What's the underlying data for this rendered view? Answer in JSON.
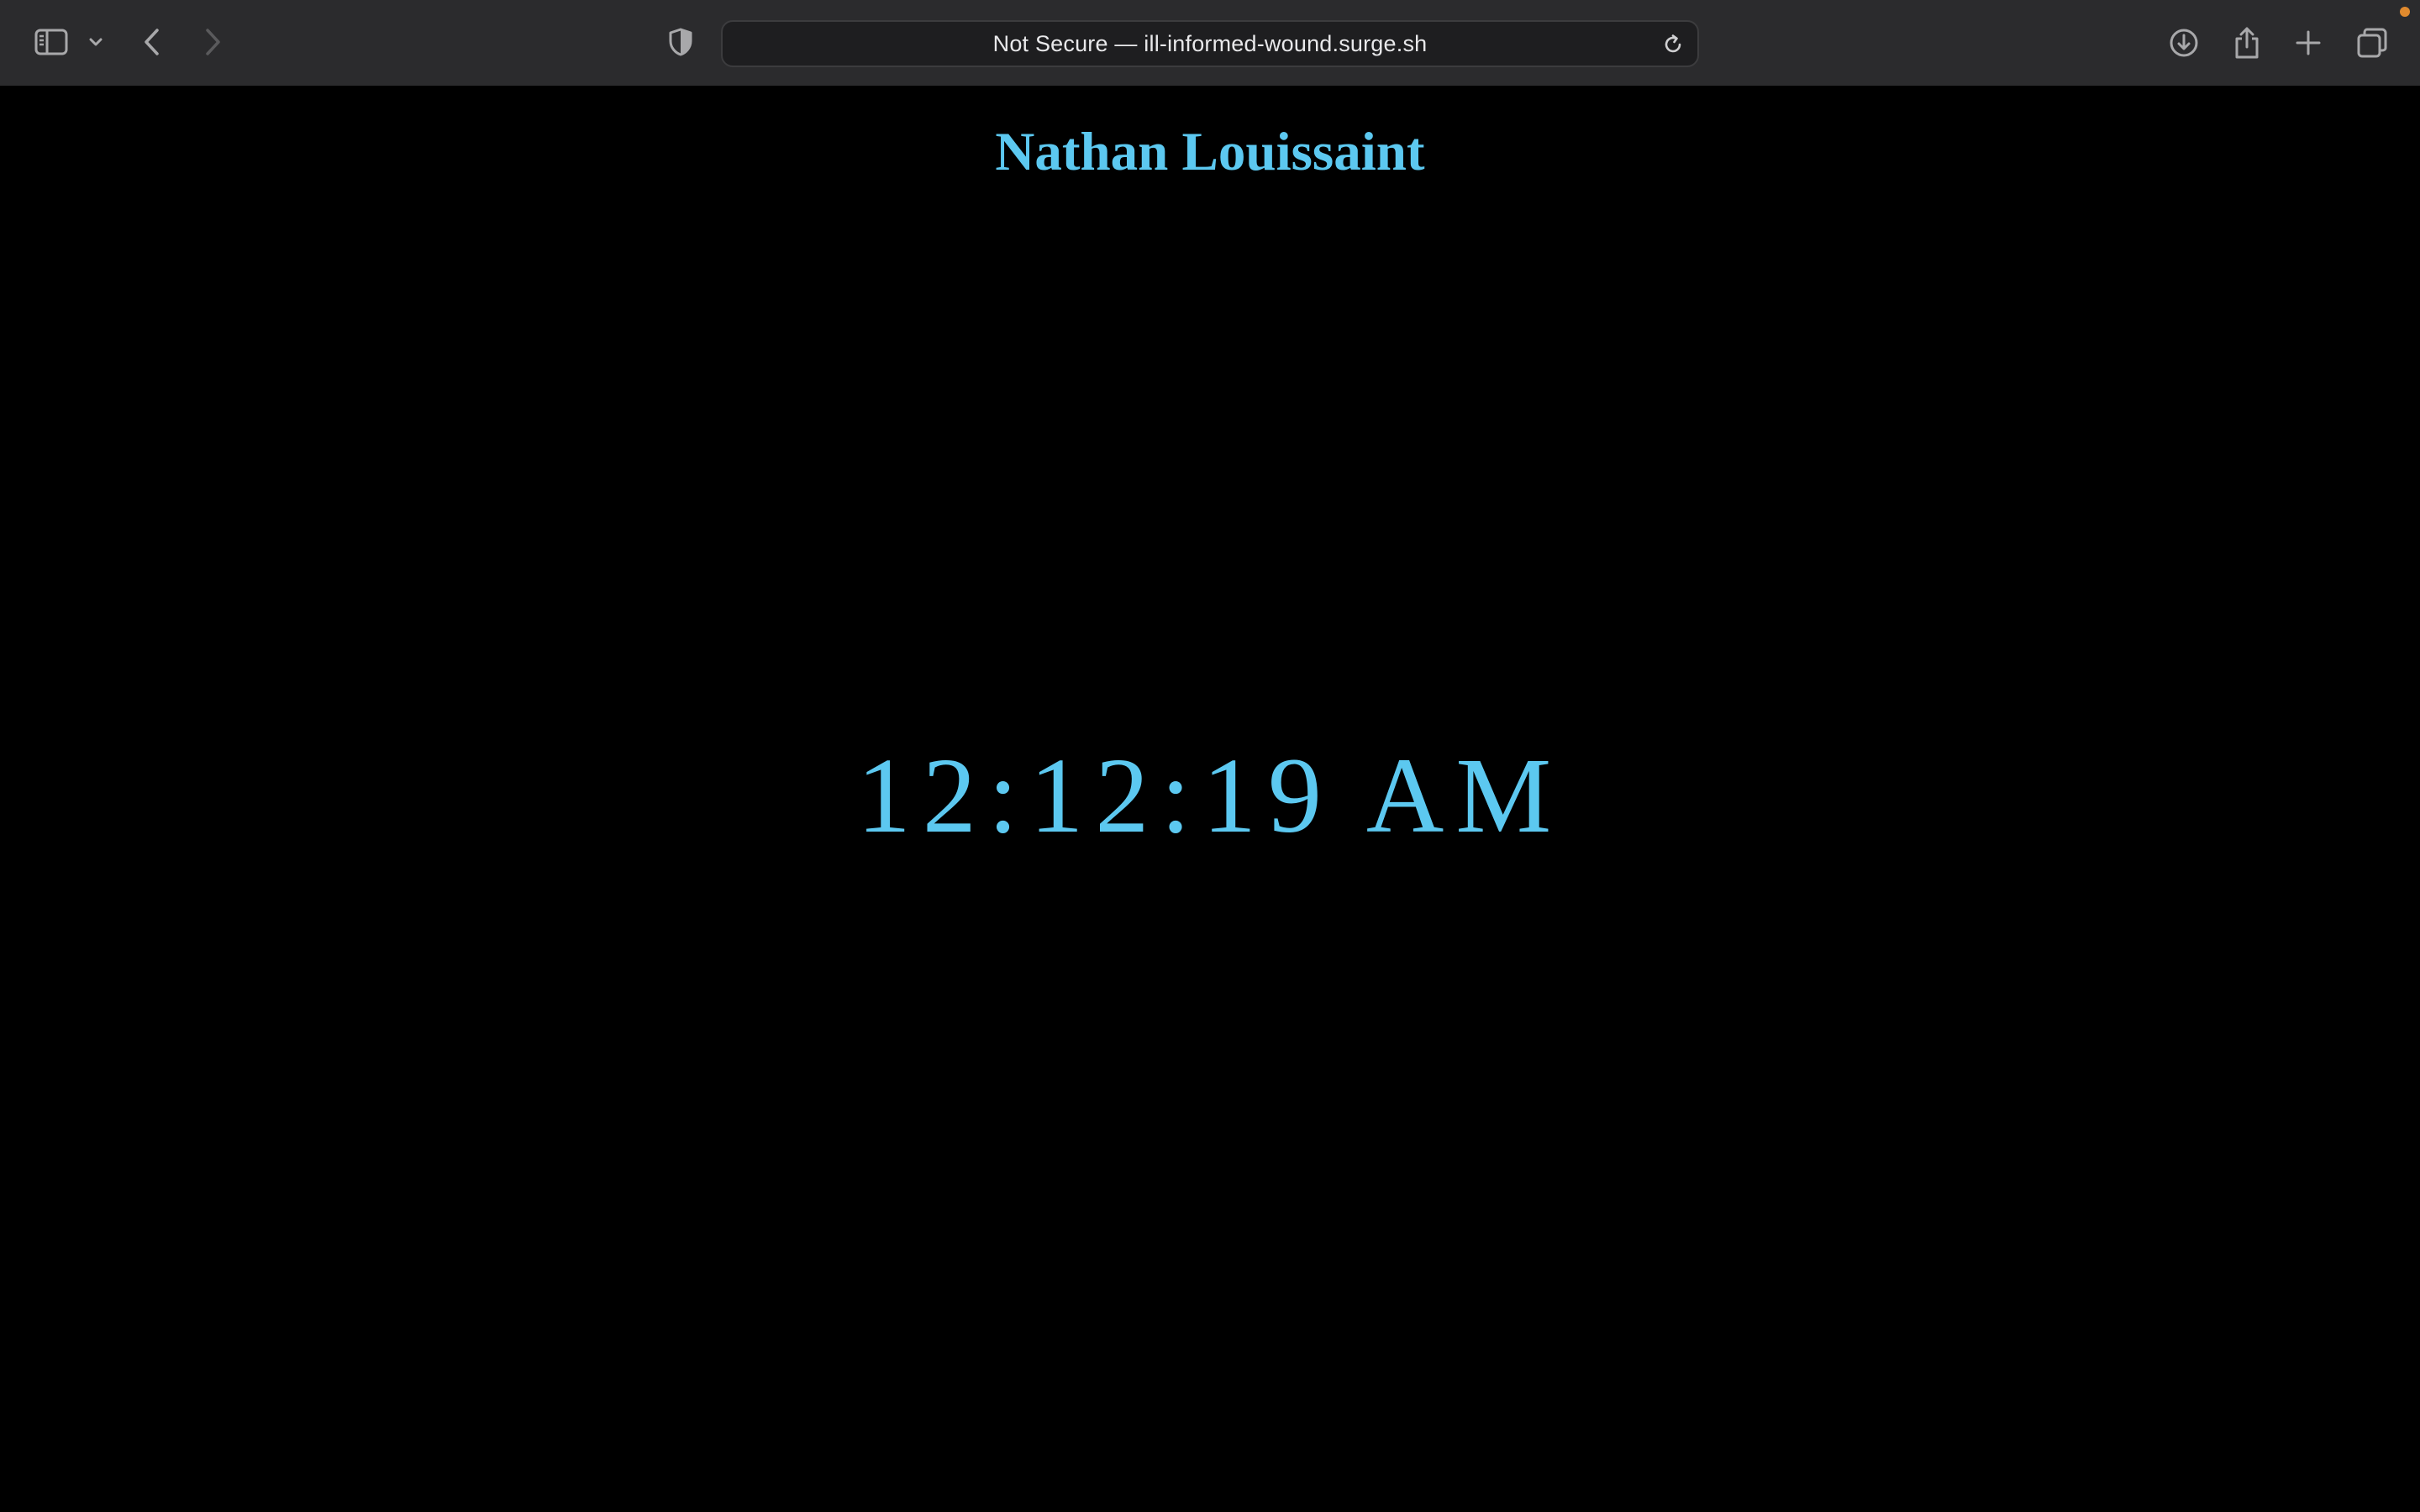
{
  "browser": {
    "address_bar": {
      "text": "Not Secure — ill-informed-wound.surge.sh"
    },
    "icons": {
      "sidebar": "sidebar-icon",
      "tab_dropdown": "chevron-down-icon",
      "back": "back-arrow-icon",
      "forward": "forward-arrow-icon",
      "privacy": "shield-icon",
      "reload": "reload-icon",
      "downloads": "download-icon",
      "share": "share-icon",
      "new_tab": "plus-icon",
      "tab_overview": "tabs-overview-icon"
    },
    "colors": {
      "toolbar_bg": "#2b2b2d",
      "notification_dot": "#e08a2e"
    }
  },
  "page": {
    "title": "Nathan Louissaint",
    "clock_time": "12:12:19 AM",
    "colors": {
      "background": "#000000",
      "text": "#5cc8f0"
    }
  }
}
